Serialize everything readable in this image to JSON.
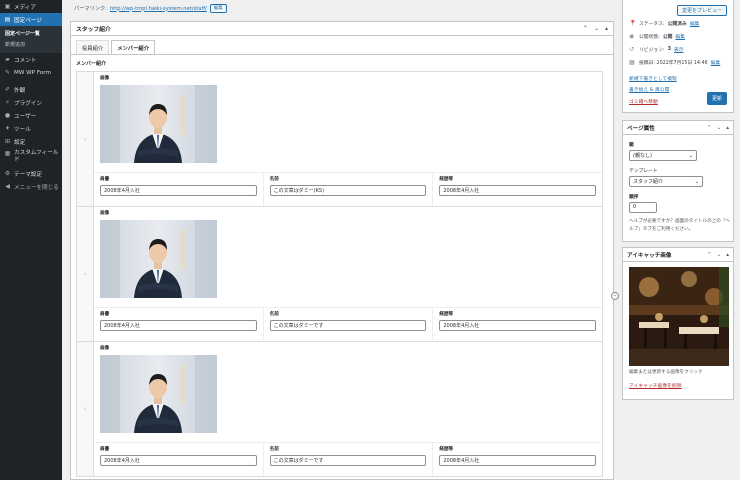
{
  "sidebar": {
    "items": [
      {
        "label": "メディア",
        "icon": "media-icon"
      },
      {
        "label": "固定ページ",
        "icon": "pages-icon",
        "active": true
      },
      {
        "label": "コメント",
        "icon": "comments-icon"
      },
      {
        "label": "MW WP Form",
        "icon": "mwform-icon"
      },
      {
        "label": "外観",
        "icon": "appearance-icon"
      },
      {
        "label": "プラグイン",
        "icon": "plugins-icon"
      },
      {
        "label": "ユーザー",
        "icon": "users-icon"
      },
      {
        "label": "ツール",
        "icon": "tools-icon"
      },
      {
        "label": "設定",
        "icon": "settings-icon"
      },
      {
        "label": "カスタムフィールド",
        "icon": "custom-fields-icon"
      },
      {
        "label": "テーマ設定",
        "icon": "theme-settings-icon"
      }
    ],
    "submenu": [
      "固定ページ一覧",
      "新規追加"
    ],
    "collapse_label": "メニューを閉じる"
  },
  "permalink": {
    "label": "パーマリンク:",
    "url": "http://wp-tmpl.halki-system.net/staff/",
    "edit_label": "編集"
  },
  "postbox": {
    "title": "スタッフ紹介",
    "tabs": [
      "役員紹介",
      "メンバー紹介"
    ],
    "repeater_label": "メンバー紹介",
    "image_label": "画像",
    "field_labels": [
      "肩書",
      "名前",
      "経歴等"
    ],
    "rows": [
      {
        "title": "2008年4月入社",
        "name": "この文章はダミー(KS)",
        "career": "2008年4月入社"
      },
      {
        "title": "2008年4月入社",
        "name": "この文章はダミーです",
        "career": "2008年4月入社"
      },
      {
        "title": "2008年4月入社",
        "name": "この文章はダミーです",
        "career": "2008年4月入社"
      }
    ]
  },
  "publish": {
    "preview_label": "変更をプレビュー",
    "status_label": "ステータス:",
    "status_value": "公開済み",
    "status_edit": "編集",
    "visibility_label": "公開状態:",
    "visibility_value": "公開",
    "visibility_edit": "編集",
    "revisions_label": "リビジョン:",
    "revisions_count": "3",
    "revisions_link": "表示",
    "date_label": "投稿日: 2022年7月15日 14:46",
    "date_edit": "編集",
    "copy_label": "新規下書きとして複製",
    "rewrite_label": "書き換え & 再公開",
    "trash_label": "ゴミ箱へ移動",
    "update_label": "更新"
  },
  "page_attributes": {
    "title": "ページ属性",
    "parent_label": "親",
    "parent_value": "(親なし)",
    "template_label": "テンプレート",
    "template_value": "スタッフ紹介",
    "order_label": "順序",
    "order_value": "0",
    "help": "ヘルプが必要ですか？画面のタイトルの上の「ヘルプ」タブをご利用ください。"
  },
  "featured_image": {
    "title": "アイキャッチ画像",
    "hint": "編集または更新する画像をクリック",
    "remove_label": "アイキャッチ画像を削除"
  }
}
